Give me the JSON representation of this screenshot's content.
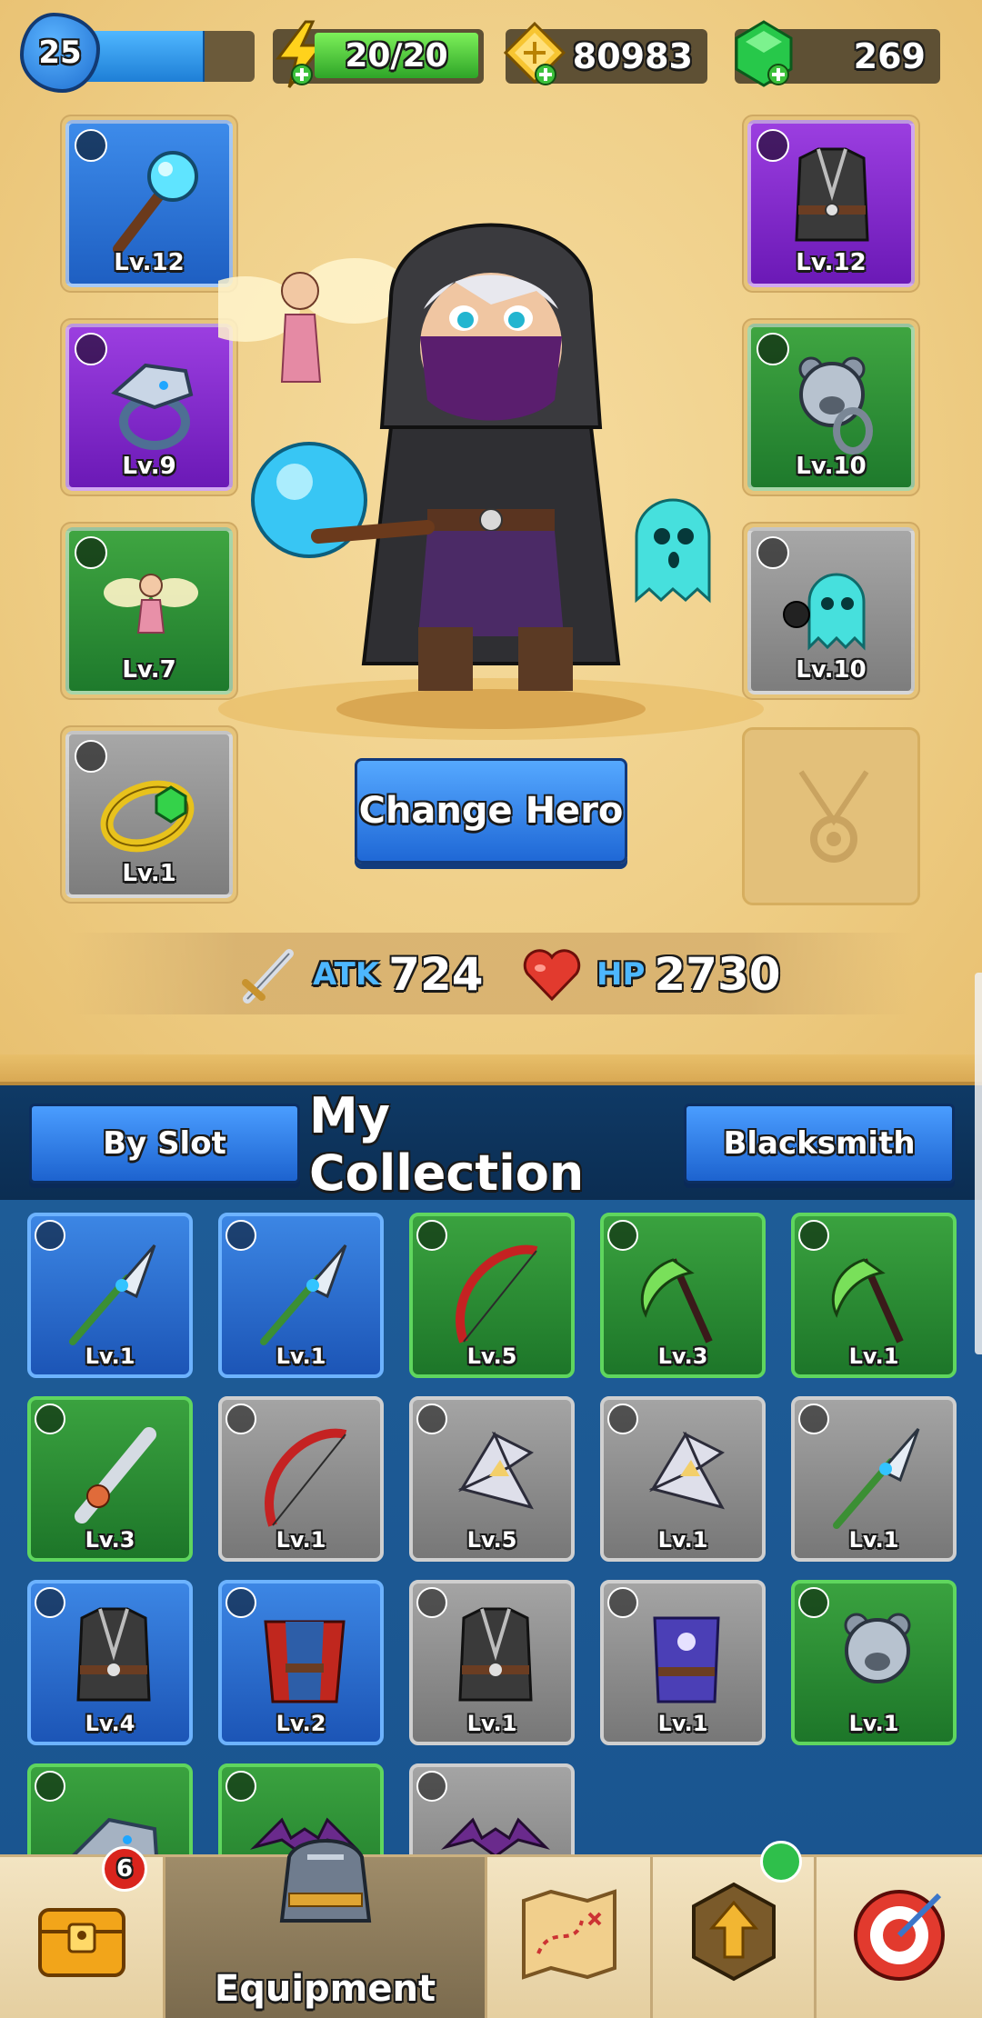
{
  "status_bar": {
    "level": "25",
    "level_progress": 0.74,
    "energy": "20/20",
    "gold": "80983",
    "gems": "269"
  },
  "equipped": {
    "weapon": {
      "level": "Lv.12",
      "rarity": "blue",
      "icon": "staff-icon"
    },
    "ring": {
      "level": "Lv.9",
      "rarity": "purple",
      "icon": "dragon-ring-icon"
    },
    "pet_left": {
      "level": "Lv.7",
      "rarity": "green",
      "icon": "fairy-pet-icon"
    },
    "bracelet": {
      "level": "Lv.1",
      "rarity": "grey",
      "icon": "gold-bracelet-icon"
    },
    "armor": {
      "level": "Lv.12",
      "rarity": "purple",
      "icon": "dark-armor-icon"
    },
    "ring2": {
      "level": "Lv.10",
      "rarity": "green",
      "icon": "bear-ring-icon"
    },
    "pet_right": {
      "level": "Lv.10",
      "rarity": "grey",
      "icon": "ghost-pet-icon"
    },
    "amulet": {
      "icon": "amulet-icon"
    }
  },
  "hero": {
    "change_label": "Change Hero",
    "atk_label": "ATK",
    "atk_value": "724",
    "hp_label": "HP",
    "hp_value": "2730"
  },
  "collection": {
    "title": "My Collection",
    "by_slot_label": "By Slot",
    "blacksmith_label": "Blacksmith",
    "items": [
      {
        "level": "Lv.1",
        "rarity": "blue",
        "icon": "spear-icon"
      },
      {
        "level": "Lv.1",
        "rarity": "blue",
        "icon": "spear-icon"
      },
      {
        "level": "Lv.5",
        "rarity": "green",
        "icon": "bow-icon"
      },
      {
        "level": "Lv.3",
        "rarity": "green",
        "icon": "scythe-icon"
      },
      {
        "level": "Lv.1",
        "rarity": "green",
        "icon": "scythe-icon"
      },
      {
        "level": "Lv.3",
        "rarity": "green",
        "icon": "spiked-sword-icon"
      },
      {
        "level": "Lv.1",
        "rarity": "grey",
        "icon": "bow-icon"
      },
      {
        "level": "Lv.5",
        "rarity": "grey",
        "icon": "shuriken-icon"
      },
      {
        "level": "Lv.1",
        "rarity": "grey",
        "icon": "shuriken-icon"
      },
      {
        "level": "Lv.1",
        "rarity": "grey",
        "icon": "spear-icon"
      },
      {
        "level": "Lv.4",
        "rarity": "blue",
        "icon": "dark-armor-icon"
      },
      {
        "level": "Lv.2",
        "rarity": "blue",
        "icon": "red-cloak-icon"
      },
      {
        "level": "Lv.1",
        "rarity": "grey",
        "icon": "dark-armor-icon"
      },
      {
        "level": "Lv.1",
        "rarity": "grey",
        "icon": "moon-robe-icon"
      },
      {
        "level": "Lv.1",
        "rarity": "green",
        "icon": "bear-ring-icon"
      },
      {
        "level": "",
        "rarity": "green",
        "icon": "dragon-ring-icon"
      },
      {
        "level": "",
        "rarity": "green",
        "icon": "bat-pet-icon"
      },
      {
        "level": "",
        "rarity": "grey",
        "icon": "bat-pet-icon"
      }
    ]
  },
  "nav": {
    "chest_badge": "6",
    "equipment_label": "Equipment",
    "tabs": [
      "treasure-chest-icon",
      "armor-helmet-icon",
      "map-icon",
      "upgrade-arrow-icon",
      "target-icon"
    ]
  },
  "colors": {
    "blue": "#2a70d4",
    "green": "#2a8f36",
    "grey": "#8f8f8f",
    "purple": "#8a2fd2",
    "gold_bg": "#efcf88",
    "collection_bg": "#1e5c97"
  }
}
